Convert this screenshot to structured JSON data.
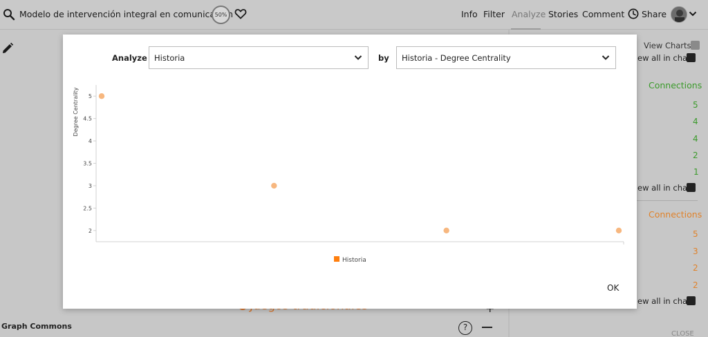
{
  "header": {
    "title": "Modelo de intervención integral en comunicación",
    "progress_label": "50%",
    "nav": [
      "Info",
      "Filter",
      "Analyze",
      "Stories",
      "Comment",
      "Share"
    ],
    "active_nav": "Analyze"
  },
  "background": {
    "orange_item": "Juegos tradicionales",
    "footer_brand": "Graph Commons",
    "help_label": "?"
  },
  "right_panel": {
    "view_charts": "View Charts",
    "view_all": "ew all in chart",
    "connections_label": "Connections",
    "green_values": [
      "5",
      "4",
      "4",
      "2",
      "1"
    ],
    "orange_values": [
      "5",
      "3",
      "2",
      "2"
    ],
    "close_label": "CLOSE",
    "colors": {
      "green": "#3a9a2a",
      "orange": "#e0822a"
    }
  },
  "modal": {
    "analyze_label": "Analyze",
    "analyze_value": "Historia",
    "by_label": "by",
    "by_value": "Historia - Degree Centrality",
    "ok_label": "OK"
  },
  "chart_data": {
    "type": "scatter",
    "ylabel": "Degree Centrality",
    "ylim": [
      1.75,
      5.25
    ],
    "yticks": [
      "5",
      "4.5",
      "4",
      "3.5",
      "3",
      "2.5",
      "2"
    ],
    "series": [
      {
        "name": "Historia",
        "color": "#f7b77f",
        "points": [
          [
            1,
            5
          ],
          [
            2,
            3
          ],
          [
            3,
            2
          ],
          [
            4,
            2
          ]
        ]
      }
    ],
    "legend": "bottom-center",
    "grid": false
  }
}
